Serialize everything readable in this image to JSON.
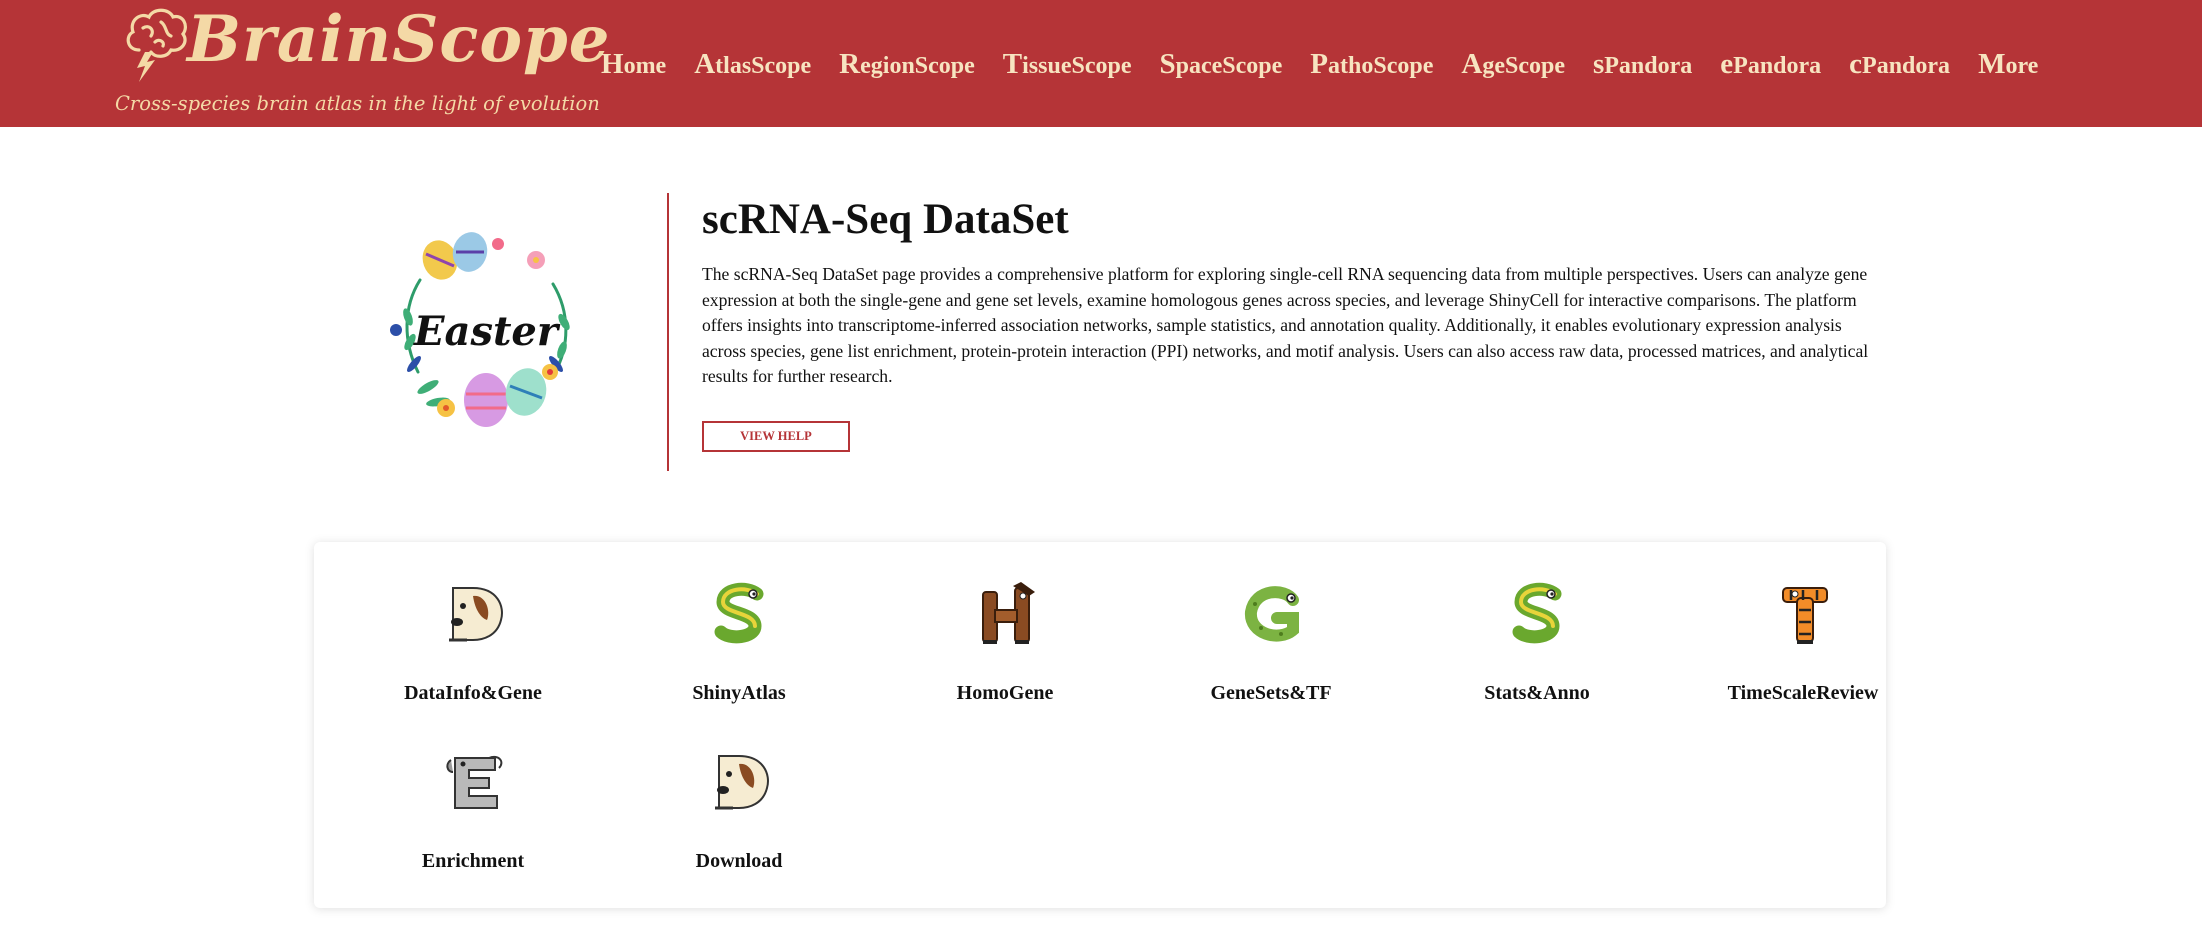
{
  "brand": {
    "name": "BrainScope",
    "tagline": "Cross-species brain atlas in the light of evolution",
    "logo_icon": "brain-lightning-icon"
  },
  "nav": {
    "items": [
      {
        "cap": "H",
        "rest": "ome"
      },
      {
        "cap": "A",
        "rest": "tlasScope"
      },
      {
        "cap": "R",
        "rest": "egionScope"
      },
      {
        "cap": "T",
        "rest": "issueScope"
      },
      {
        "cap": "S",
        "rest": "paceScope"
      },
      {
        "cap": "P",
        "rest": "athoScope"
      },
      {
        "cap": "A",
        "rest": "geScope"
      },
      {
        "cap": "s",
        "rest": "Pandora"
      },
      {
        "cap": "e",
        "rest": "Pandora"
      },
      {
        "cap": "c",
        "rest": "Pandora"
      },
      {
        "cap": "M",
        "rest": "ore"
      }
    ]
  },
  "intro": {
    "logo_text": "Easter",
    "title": "scRNA-Seq DataSet",
    "description": "The scRNA-Seq DataSet page provides a comprehensive platform for exploring single-cell RNA sequencing data from multiple perspectives. Users can analyze gene expression at both the single-gene and gene set levels, examine homologous genes across species, and leverage ShinyCell for interactive comparisons. The platform offers insights into transcriptome-inferred association networks, sample statistics, and annotation quality. Additionally, it enables evolutionary expression analysis across species, gene list enrichment, protein-protein interaction (PPI) networks, and motif analysis. Users can also access raw data, processed matrices, and analytical results for further research.",
    "help_label": "VIEW HELP"
  },
  "tools": [
    {
      "label": "DataInfo&Gene",
      "letter": "D",
      "icon": "dog-letter-d-icon"
    },
    {
      "label": "ShinyAtlas",
      "letter": "S",
      "icon": "snake-letter-s-icon"
    },
    {
      "label": "HomoGene",
      "letter": "H",
      "icon": "horse-letter-h-icon"
    },
    {
      "label": "GeneSets&TF",
      "letter": "G",
      "icon": "gecko-letter-g-icon"
    },
    {
      "label": "Stats&Anno",
      "letter": "S",
      "icon": "snake-letter-s-icon"
    },
    {
      "label": "TimeScaleReview",
      "letter": "T",
      "icon": "tiger-letter-t-icon"
    },
    {
      "label": "Enrichment",
      "letter": "E",
      "icon": "elephant-letter-e-icon"
    },
    {
      "label": "Download",
      "letter": "D",
      "icon": "dog-letter-d-icon"
    }
  ],
  "colors": {
    "header_bg": "#b53437",
    "brand_text": "#f4d9a6",
    "accent": "#b53437"
  }
}
